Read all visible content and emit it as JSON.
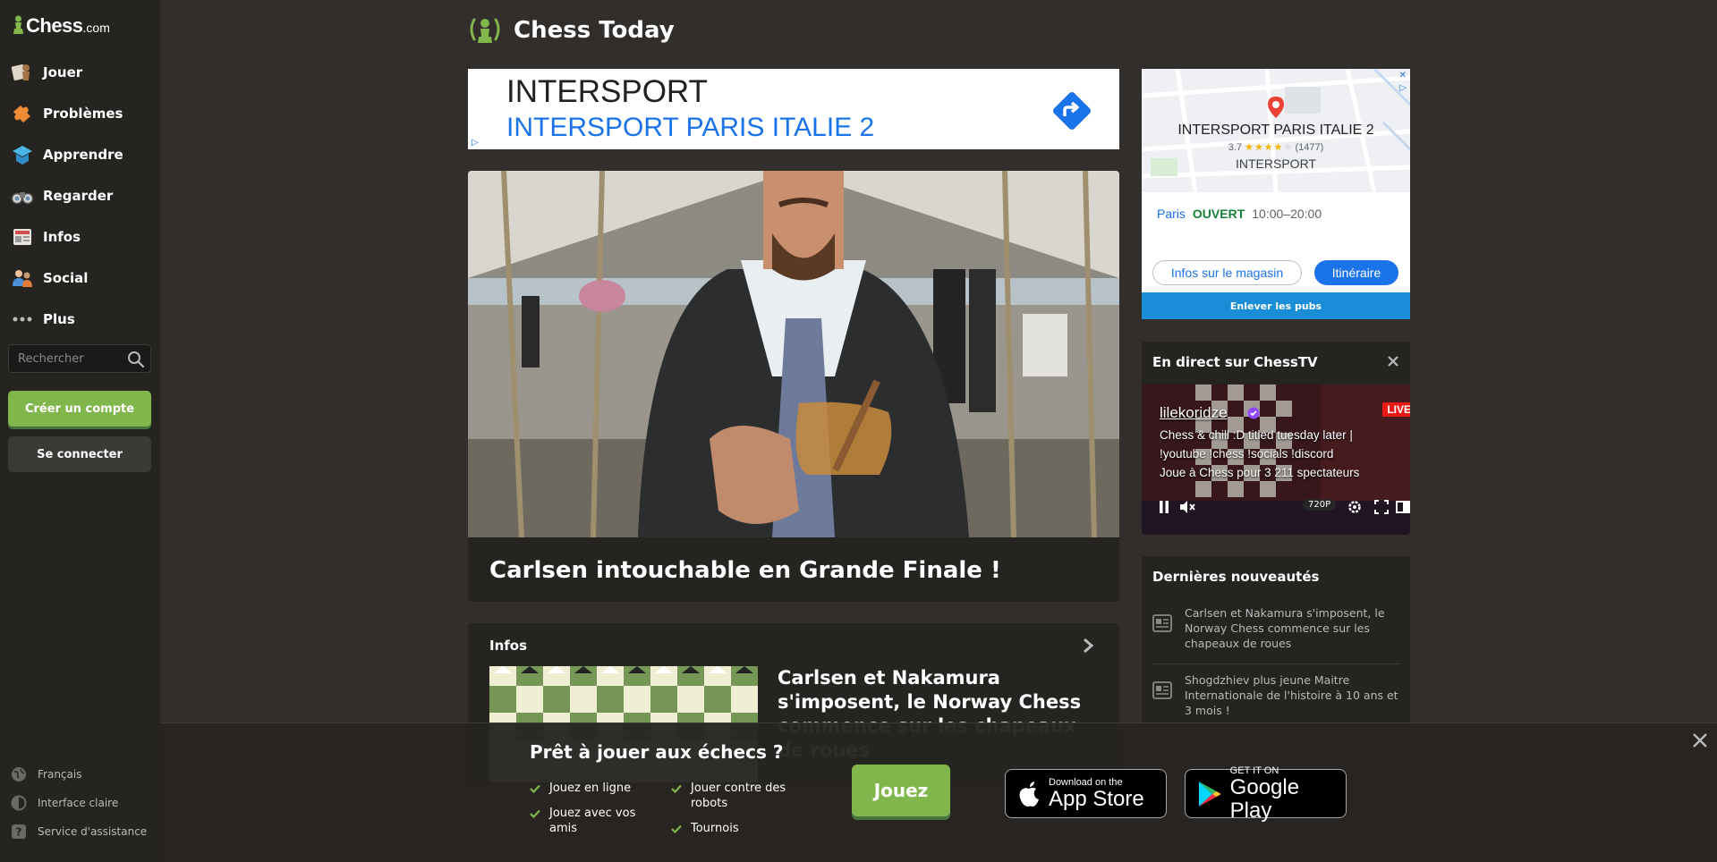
{
  "brand": {
    "name": "Chess",
    "domain": ".com"
  },
  "sidebar": {
    "items": [
      {
        "label": "Jouer",
        "icon": "play-pawn-icon"
      },
      {
        "label": "Problèmes",
        "icon": "puzzle-icon"
      },
      {
        "label": "Apprendre",
        "icon": "learn-cap-icon"
      },
      {
        "label": "Regarder",
        "icon": "binoculars-icon"
      },
      {
        "label": "Infos",
        "icon": "news-icon"
      },
      {
        "label": "Social",
        "icon": "social-icon"
      },
      {
        "label": "Plus",
        "icon": "more-dots-icon"
      }
    ],
    "search_placeholder": "Rechercher",
    "create_account": "Créer un compte",
    "login": "Se connecter",
    "footer": [
      {
        "label": "Français",
        "icon": "globe-icon"
      },
      {
        "label": "Interface claire",
        "icon": "contrast-icon"
      },
      {
        "label": "Service d'assistance",
        "icon": "help-icon"
      }
    ]
  },
  "header": {
    "title": "Chess Today"
  },
  "ad_banner": {
    "brand": "INTERSPORT",
    "store": "INTERSPORT PARIS ITALIE 2"
  },
  "feature": {
    "headline": "Carlsen intouchable en Grande Finale !"
  },
  "news": {
    "section": "Infos",
    "title": "Carlsen et Nakamura s'imposent, le Norway Chess commence sur les chapeaux de roues"
  },
  "ad_map": {
    "name": "INTERSPORT PARIS ITALIE 2",
    "rating": "3.7",
    "stars": "★★★★",
    "stars_empty": "★",
    "reviews": "(1477)",
    "brand": "INTERSPORT",
    "city": "Paris",
    "status": "OUVERT",
    "hours": "10:00–20:00",
    "btn_info": "Infos sur le magasin",
    "btn_route": "Itinéraire",
    "remove_ads": "Enlever les pubs"
  },
  "tv": {
    "title": "En direct sur ChessTV",
    "channel": "lilekoridze",
    "live": "LIVE",
    "description": "Chess & chill :D titled tuesday later | !youtube !chess !socials !discord",
    "viewers": "Joue à Chess pour 3 211 spectateurs",
    "quality": "720P"
  },
  "latest": {
    "title": "Dernières nouveautés",
    "items": [
      "Carlsen et Nakamura s'imposent, le Norway Chess commence sur les chapeaux de roues",
      "Shogdzhiev plus jeune Maitre Internationale de l'histoire à 10 ans et 3 mois !"
    ]
  },
  "promo": {
    "title": "Prêt à jouer aux échecs ?",
    "features": [
      "Jouez en ligne",
      "Jouez avec vos amis",
      "Jouer contre des robots",
      "Tournois"
    ],
    "play": "Jouez",
    "appstore_small": "Download on the",
    "appstore_large": "App Store",
    "google_small": "GET IT ON",
    "google_large": "Google Play"
  },
  "colors": {
    "accent_green": "#81b64c",
    "sidebar_bg": "#262421",
    "page_bg": "#312e2b",
    "link_blue": "#1a73e8"
  }
}
